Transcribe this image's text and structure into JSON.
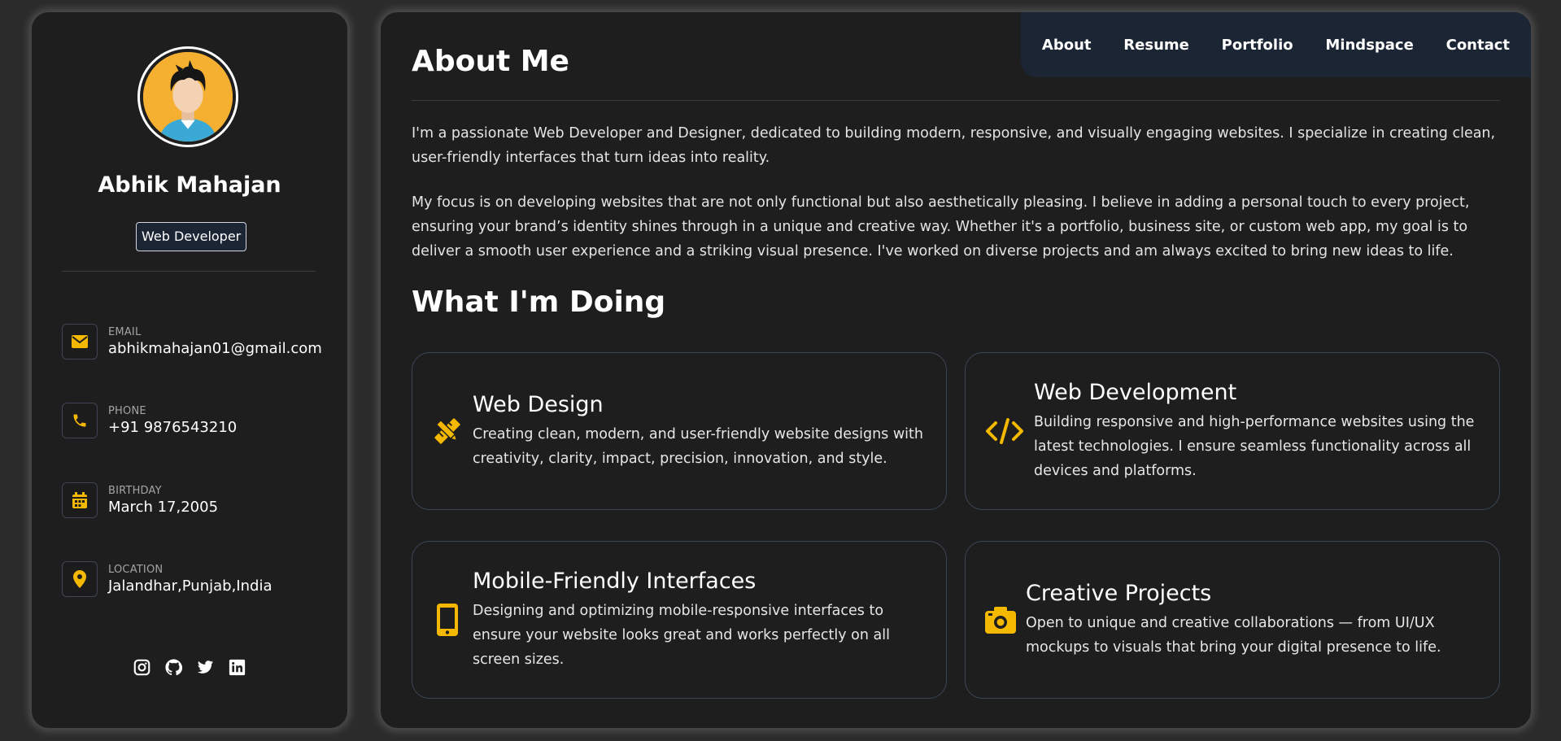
{
  "profile": {
    "name": "Abhik Mahajan",
    "role": "Web Developer"
  },
  "contacts": [
    {
      "label": "EMAIL",
      "value": "abhikmahajan01@gmail.com",
      "icon": "envelope-icon"
    },
    {
      "label": "PHONE",
      "value": "+91 9876543210",
      "icon": "phone-icon"
    },
    {
      "label": "BIRTHDAY",
      "value": "March 17,2005",
      "icon": "calendar-icon"
    },
    {
      "label": "LOCATION",
      "value": "Jalandhar,Punjab,India",
      "icon": "location-pin-icon"
    }
  ],
  "socials": [
    "instagram-icon",
    "github-icon",
    "twitter-icon",
    "linkedin-icon"
  ],
  "nav": [
    "About",
    "Resume",
    "Portfolio",
    "Mindspace",
    "Contact"
  ],
  "about": {
    "heading": "About Me",
    "paragraphs": [
      "I'm a passionate Web Developer and Designer, dedicated to building modern, responsive, and visually engaging websites. I specialize in creating clean, user-friendly interfaces that turn ideas into reality.",
      "My focus is on developing websites that are not only functional but also aesthetically pleasing. I believe in adding a personal touch to every project, ensuring your brand’s identity shines through in a unique and creative way. Whether it's a portfolio, business site, or custom web app, my goal is to deliver a smooth user experience and a striking visual presence. I've worked on diverse projects and am always excited to bring new ideas to life."
    ]
  },
  "doing": {
    "heading": "What I'm Doing",
    "services": [
      {
        "title": "Web Design",
        "desc": "Creating clean, modern, and user-friendly website designs with creativity, clarity, impact, precision, innovation, and style.",
        "icon": "pencil-ruler-icon"
      },
      {
        "title": "Web Development",
        "desc": "Building responsive and high-performance websites using the latest technologies. I ensure seamless functionality across all devices and platforms.",
        "icon": "code-icon"
      },
      {
        "title": "Mobile-Friendly Interfaces",
        "desc": "Designing and optimizing mobile-responsive interfaces to ensure your website looks great and works perfectly on all screen sizes.",
        "icon": "mobile-phone-icon"
      },
      {
        "title": "Creative Projects",
        "desc": "Open to unique and creative collaborations — from UI/UX mockups to visuals that bring your digital presence to life.",
        "icon": "camera-icon"
      }
    ]
  },
  "colors": {
    "accent": "#f5b800",
    "panel": "#1e1e1e",
    "background": "#2b2b2b",
    "nav": "#1c2533"
  }
}
